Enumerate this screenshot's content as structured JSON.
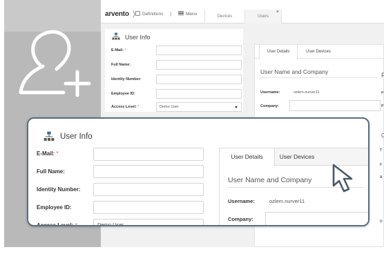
{
  "topbar": {
    "logo": "arvento",
    "crumb_definitions": "Definitions",
    "crumb_menu": "Menu",
    "tabs": [
      {
        "label": "Devices"
      },
      {
        "label": "Users"
      }
    ],
    "close_glyph": "×"
  },
  "form": {
    "title": "User Info",
    "fields": [
      {
        "label": "E-Mail:",
        "required": "*",
        "value": ""
      },
      {
        "label": "Full Name:",
        "value": ""
      },
      {
        "label": "Identity Number:",
        "value": ""
      },
      {
        "label": "Employee ID:",
        "value": ""
      },
      {
        "label": "Access Level:",
        "required": "*",
        "value": "Demo User"
      }
    ]
  },
  "details": {
    "tabs": [
      {
        "label": "User Details"
      },
      {
        "label": "User Devices"
      }
    ],
    "section_title": "User Name and Company",
    "username_label": "Username:",
    "username_value": "ozlem.nurver11",
    "company_label": "Company:",
    "company_value": ""
  },
  "far_right": {
    "letters": [
      "P",
      "P",
      "P",
      "C",
      "T",
      "F",
      "A",
      "U"
    ]
  },
  "icons": {
    "add_user": "add-user-icon",
    "org": "org-chart-icon",
    "cursor": "mouse-pointer-icon"
  }
}
